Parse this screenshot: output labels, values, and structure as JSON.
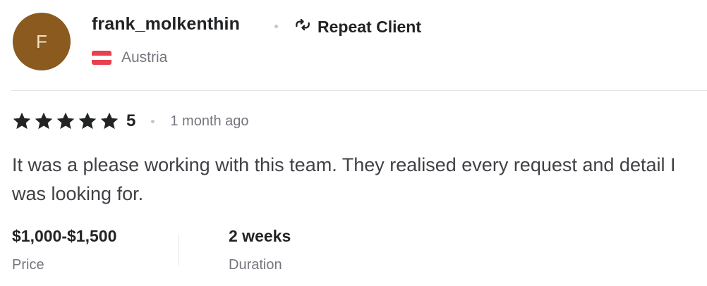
{
  "reviewer": {
    "avatar_initial": "F",
    "username": "frank_molkenthin",
    "badge_label": "Repeat Client",
    "country": "Austria"
  },
  "review": {
    "rating": "5",
    "stars_count": 5,
    "time_ago": "1 month ago",
    "text": "It was a please working with this team. They realised every request and detail I was looking for."
  },
  "details": {
    "price_value": "$1,000-$1,500",
    "price_label": "Price",
    "duration_value": "2 weeks",
    "duration_label": "Duration"
  },
  "colors": {
    "avatar_bg": "#8a5a1f",
    "flag_red": "#e8404c",
    "flag_white": "#ffffff"
  }
}
